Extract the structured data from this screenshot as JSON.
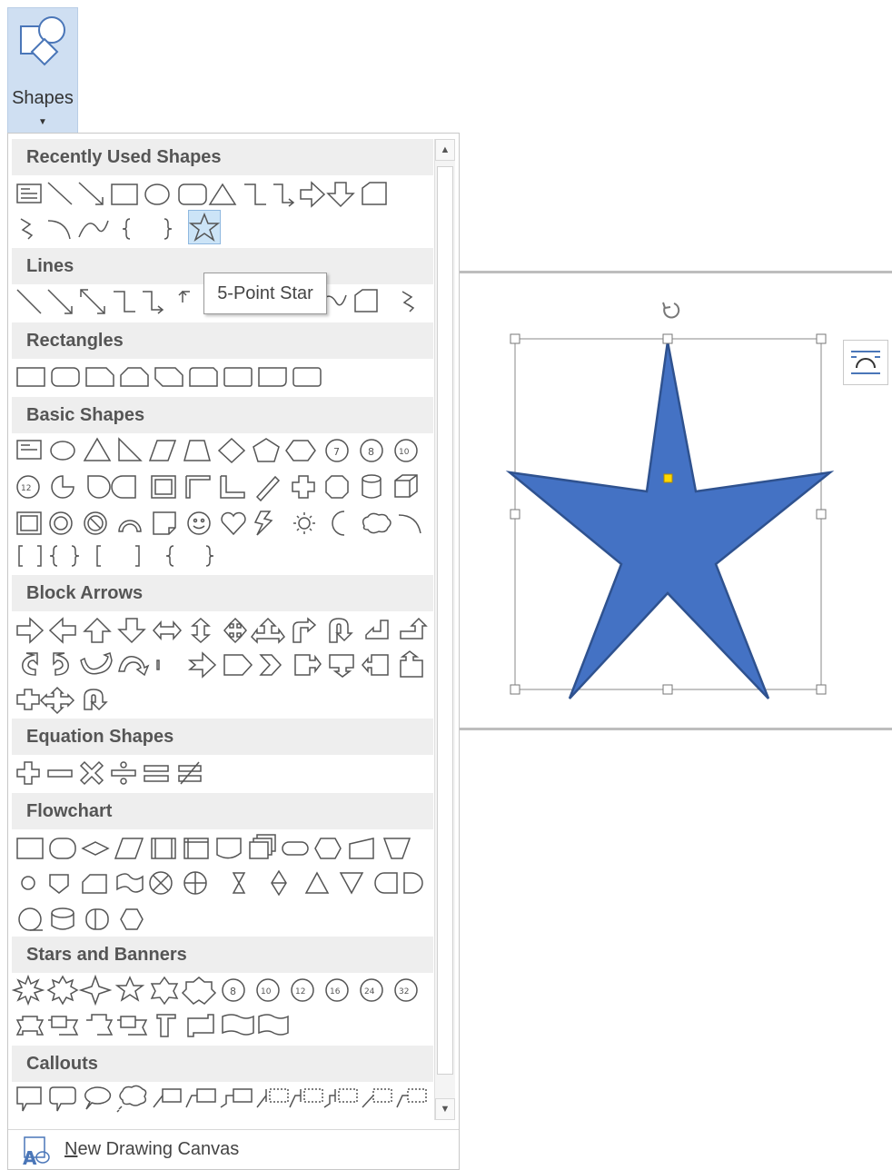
{
  "ribbon": {
    "shapes_button_label": "Shapes"
  },
  "menu": {
    "sections": {
      "recently_used": "Recently Used Shapes",
      "lines": "Lines",
      "rectangles": "Rectangles",
      "basic_shapes": "Basic Shapes",
      "block_arrows": "Block Arrows",
      "equation_shapes": "Equation Shapes",
      "flowchart": "Flowchart",
      "stars_banners": "Stars and Banners",
      "callouts": "Callouts"
    },
    "new_drawing_canvas_prefix": "N",
    "new_drawing_canvas_rest": "ew Drawing Canvas",
    "selected_item": "5-Point Star"
  },
  "tooltip": {
    "text": "5-Point Star"
  },
  "document": {
    "star_fill": "#4472c4",
    "star_stroke": "#2f528f",
    "handle_color": "#ffd800",
    "menu_highlight": "#cce4f7"
  },
  "icons": {
    "shapes": "shapes-icon",
    "new_canvas": "new-drawing-canvas-icon",
    "rotate": "rotate-handle-icon",
    "layout_options": "layout-options-icon"
  }
}
